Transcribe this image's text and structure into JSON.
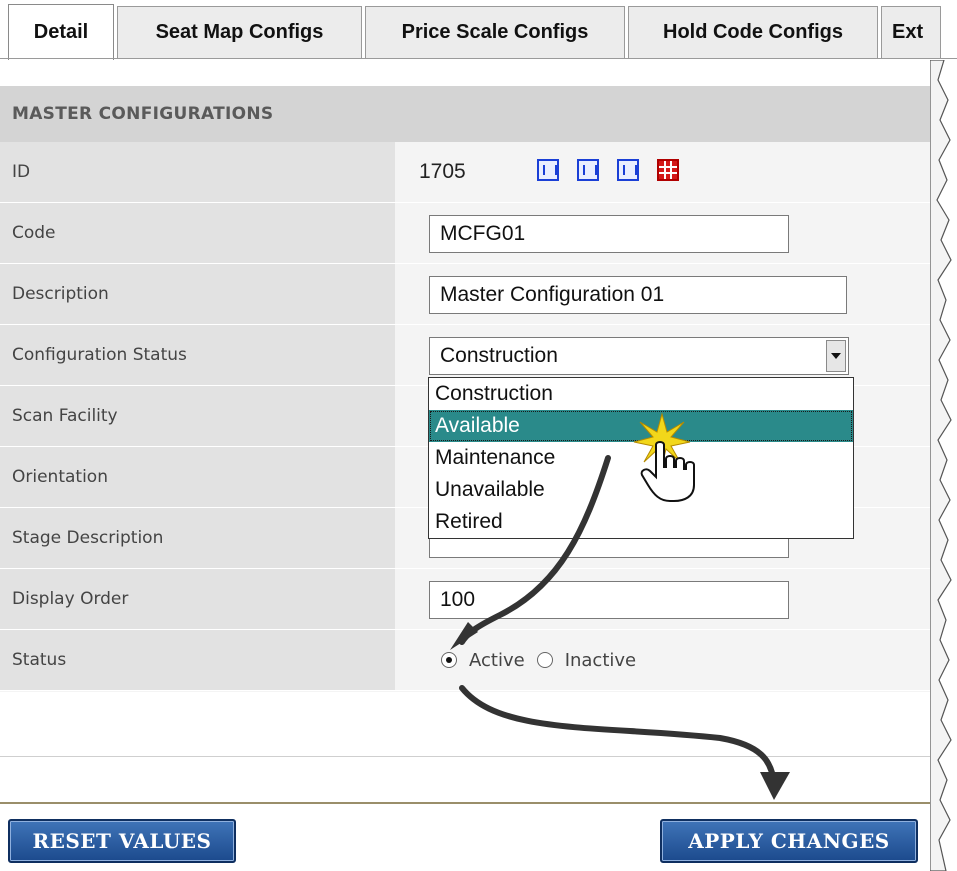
{
  "tabs": [
    {
      "label": "Detail",
      "active": true
    },
    {
      "label": "Seat Map Configs",
      "active": false
    },
    {
      "label": "Price Scale Configs",
      "active": false
    },
    {
      "label": "Hold Code Configs",
      "active": false
    },
    {
      "label": "Ext",
      "active": false
    }
  ],
  "section": {
    "title": "MASTER CONFIGURATIONS"
  },
  "form": {
    "id": {
      "label": "ID",
      "value": "1705",
      "icons": [
        "layout-icon",
        "layout-icon",
        "layout-icon",
        "seat-grid-icon"
      ]
    },
    "code": {
      "label": "Code",
      "value": "MCFG01"
    },
    "description": {
      "label": "Description",
      "value": "Master Configuration 01"
    },
    "configuration_status": {
      "label": "Configuration Status",
      "value": "Construction",
      "options": [
        "Construction",
        "Available",
        "Maintenance",
        "Unavailable",
        "Retired"
      ],
      "highlighted": "Available"
    },
    "scan_facility": {
      "label": "Scan Facility"
    },
    "orientation": {
      "label": "Orientation"
    },
    "stage_description": {
      "label": "Stage Description"
    },
    "display_order": {
      "label": "Display Order",
      "value": "100"
    },
    "status": {
      "label": "Status",
      "options": [
        "Active",
        "Inactive"
      ],
      "selected": "Active"
    }
  },
  "buttons": {
    "reset": "RESET VALUES",
    "apply": "APPLY CHANGES"
  },
  "colors": {
    "button": "#2b5c9e",
    "highlight": "#2a8a8a",
    "header": "#d4d4d4"
  }
}
